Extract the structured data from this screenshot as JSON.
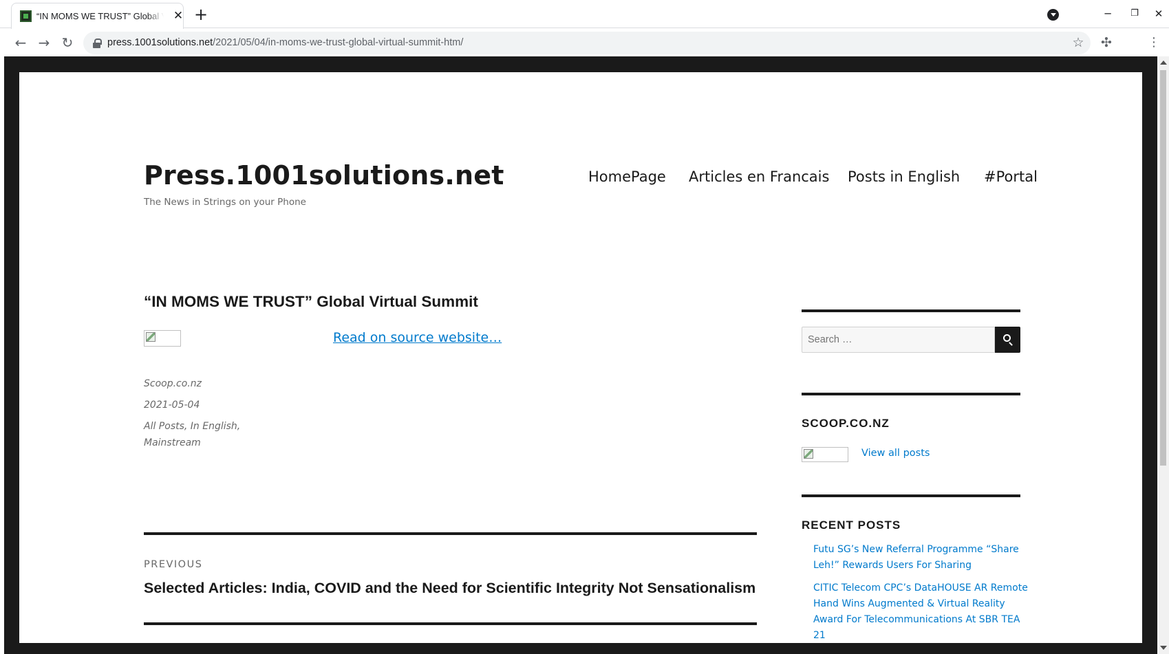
{
  "browser": {
    "tab_title": "“IN MOMS WE TRUST” Global Virtual Summit",
    "url_host": "press.1001solutions.net",
    "url_path": "/2021/05/04/in-moms-we-trust-global-virtual-summit-htm/"
  },
  "site": {
    "title": "Press.1001solutions.net",
    "description": "The News in Strings on your Phone"
  },
  "nav": {
    "items": [
      {
        "label": "HomePage"
      },
      {
        "label": "Articles en Francais"
      },
      {
        "label": "Posts in English"
      },
      {
        "label": "#Portal"
      }
    ]
  },
  "article": {
    "title": "“IN MOMS WE TRUST” Global Virtual Summit",
    "read_more": "Read on source website…",
    "source": "Scoop.co.nz",
    "date": "2021-05-04",
    "categories": "All Posts, In English, Mainstream"
  },
  "post_nav": {
    "label": "PREVIOUS",
    "title": "Selected Articles: India, COVID and the Need for Scientific Integrity Not Sensationalism"
  },
  "sidebar": {
    "search_placeholder": "Search …",
    "author_title": "SCOOP.CO.NZ",
    "view_all": "View all posts",
    "recent_title": "RECENT POSTS",
    "recent_posts": [
      "Futu SG’s New Referral Programme “Share Leh!” Rewards Users For Sharing",
      "CITIC Telecom CPC’s DataHOUSE AR Remote Hand Wins Augmented & Virtual Reality Award For Telecommunications At SBR TEA 21"
    ]
  },
  "colors": {
    "link": "#007acc",
    "text": "#1a1a1a",
    "muted": "#686868",
    "frame": "#1a1a1a"
  }
}
